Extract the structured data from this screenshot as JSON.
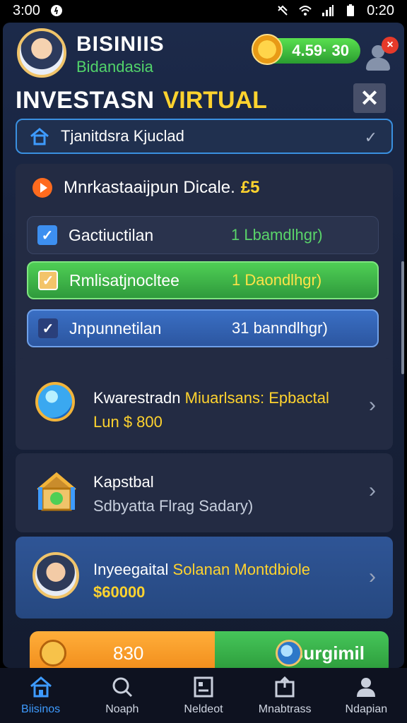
{
  "status_bar": {
    "time": "3:00",
    "clock_right": "0:20",
    "battery_icon": "battery-icon",
    "wifi_icon": "wifi-icon",
    "signal_icon": "signal-icon"
  },
  "header": {
    "app_name": "BISINIIS",
    "subtitle": "Bidandasia",
    "coin_balance": "4.59· 30",
    "notification_count": "×"
  },
  "title": {
    "main": "INVESTASN",
    "accent": "VIRTUAL",
    "close_label": "✕"
  },
  "dropdown": {
    "label": "Tjanitdsra Kjuclad",
    "chevron": "✓"
  },
  "mission": {
    "label": "Mnrkastaaijpun Dicale.",
    "value": "£5",
    "tasks": [
      {
        "name": "Gactiuctilan",
        "reward": "1 Lbamdlhgr)",
        "check": "✓"
      },
      {
        "name": "Rmlisatjnocltee",
        "reward": "1 Daondlhgr)",
        "check": "✓"
      },
      {
        "name": "Jnpunnetilan",
        "reward": "31 banndlhgr)",
        "check": "✓"
      }
    ]
  },
  "rows": [
    {
      "title": "Kwarestradn",
      "title_accent": "Miuarlsans: Epbactal",
      "subtitle": "Lun $ 800"
    },
    {
      "title": "Kapstbal",
      "subtitle": "Sdbyatta Flrag Sadary)"
    },
    {
      "title": "Inyeegaital",
      "title_accent": "Solanan Montdbiole",
      "subtitle": "$60000"
    }
  ],
  "action_bar": {
    "value": "830",
    "button_label": "Burgimil"
  },
  "tabs": [
    {
      "label": "Biisinos",
      "icon": "home-icon"
    },
    {
      "label": "Noaph",
      "icon": "search-icon"
    },
    {
      "label": "Neldeot",
      "icon": "news-icon"
    },
    {
      "label": "Mnabtrass",
      "icon": "inbox-icon"
    },
    {
      "label": "Ndapian",
      "icon": "profile-icon"
    }
  ],
  "colors": {
    "accent_yellow": "#ffd32e",
    "accent_green": "#52d46a",
    "accent_blue": "#3e9bff"
  }
}
